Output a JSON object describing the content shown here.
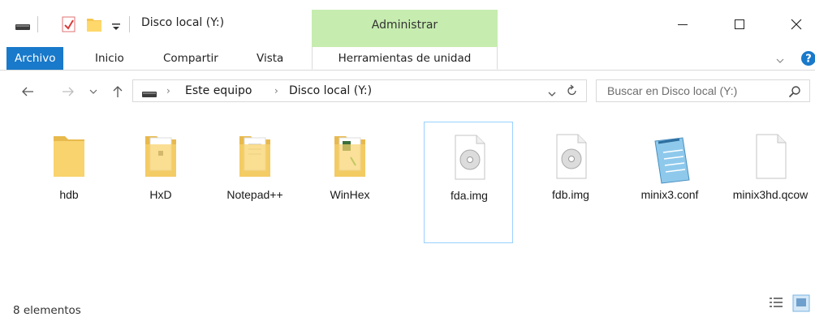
{
  "window": {
    "title": "Disco local (Y:)",
    "contextual_group": "Administrar",
    "accent_color": "#1979ca",
    "contextual_color": "#c6ecaf"
  },
  "ribbon": {
    "tabs": [
      {
        "label": "Archivo"
      },
      {
        "label": "Inicio"
      },
      {
        "label": "Compartir"
      },
      {
        "label": "Vista"
      },
      {
        "label": "Herramientas de unidad"
      }
    ]
  },
  "address": {
    "breadcrumbs": [
      "Este equipo",
      "Disco local (Y:)"
    ],
    "search_placeholder": "Buscar en Disco local (Y:)"
  },
  "items": [
    {
      "name": "hdb",
      "icon": "folder-icon"
    },
    {
      "name": "HxD",
      "icon": "folder-docs-icon"
    },
    {
      "name": "Notepad++",
      "icon": "folder-docs-icon"
    },
    {
      "name": "WinHex",
      "icon": "folder-docs-icon"
    },
    {
      "name": "fda.img",
      "icon": "disc-image-icon"
    },
    {
      "name": "fdb.img",
      "icon": "disc-image-icon"
    },
    {
      "name": "minix3.conf",
      "icon": "notepad-icon"
    },
    {
      "name": "minix3hd.qcow",
      "icon": "blank-file-icon"
    }
  ],
  "status": {
    "count_text": "8 elementos"
  }
}
